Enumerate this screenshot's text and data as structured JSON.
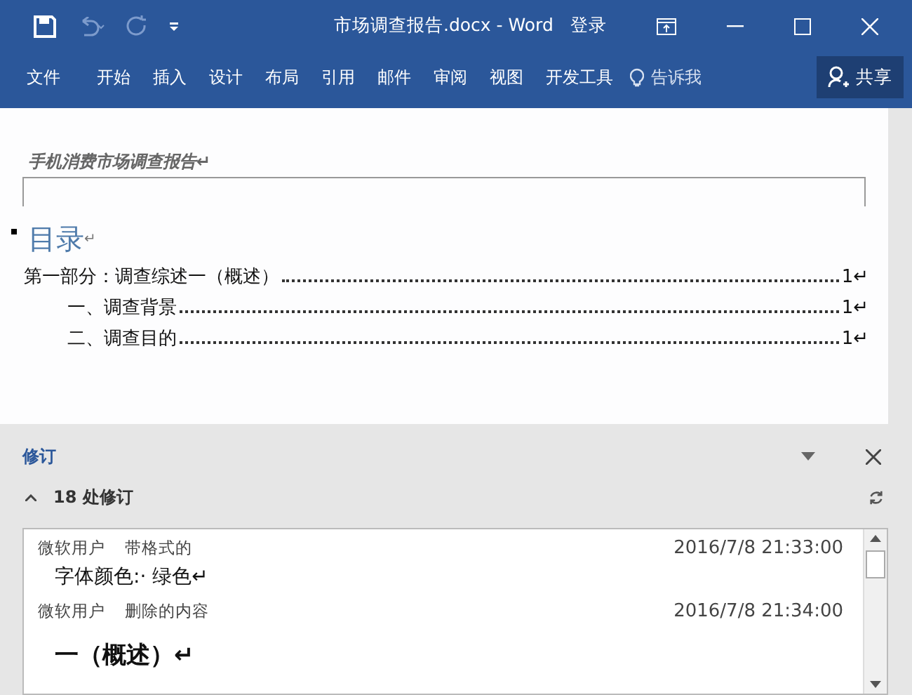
{
  "window": {
    "title": "市场调查报告.docx - Word",
    "signin": "登录"
  },
  "ribbon": {
    "tabs": [
      {
        "label": "文件"
      },
      {
        "label": "开始"
      },
      {
        "label": "插入"
      },
      {
        "label": "设计"
      },
      {
        "label": "布局"
      },
      {
        "label": "引用"
      },
      {
        "label": "邮件"
      },
      {
        "label": "审阅"
      },
      {
        "label": "视图"
      },
      {
        "label": "开发工具"
      }
    ],
    "tell_me": "告诉我",
    "share": "共享"
  },
  "document": {
    "header": "手机消费市场调查报告↵",
    "heading": "目录",
    "heading_mark": "↵",
    "toc": [
      {
        "text": "第一部分：调查综述一（概述）",
        "page": "1↵",
        "indented": false
      },
      {
        "text": "一、调查背景",
        "page": "1↵",
        "indented": true
      },
      {
        "text": "二、调查目的",
        "page": "1↵",
        "indented": true
      }
    ]
  },
  "revisions_pane": {
    "title": "修订",
    "count": "18 处修订",
    "items": [
      {
        "author": "微软用户",
        "type": "带格式的",
        "time": "2016/7/8 21:33:00",
        "content": "字体颜色:· 绿色↵",
        "kind": "format"
      },
      {
        "author": "微软用户",
        "type": "删除的内容",
        "time": "2016/7/8 21:34:00",
        "content": "一（概述）↵",
        "kind": "deletion"
      }
    ]
  }
}
